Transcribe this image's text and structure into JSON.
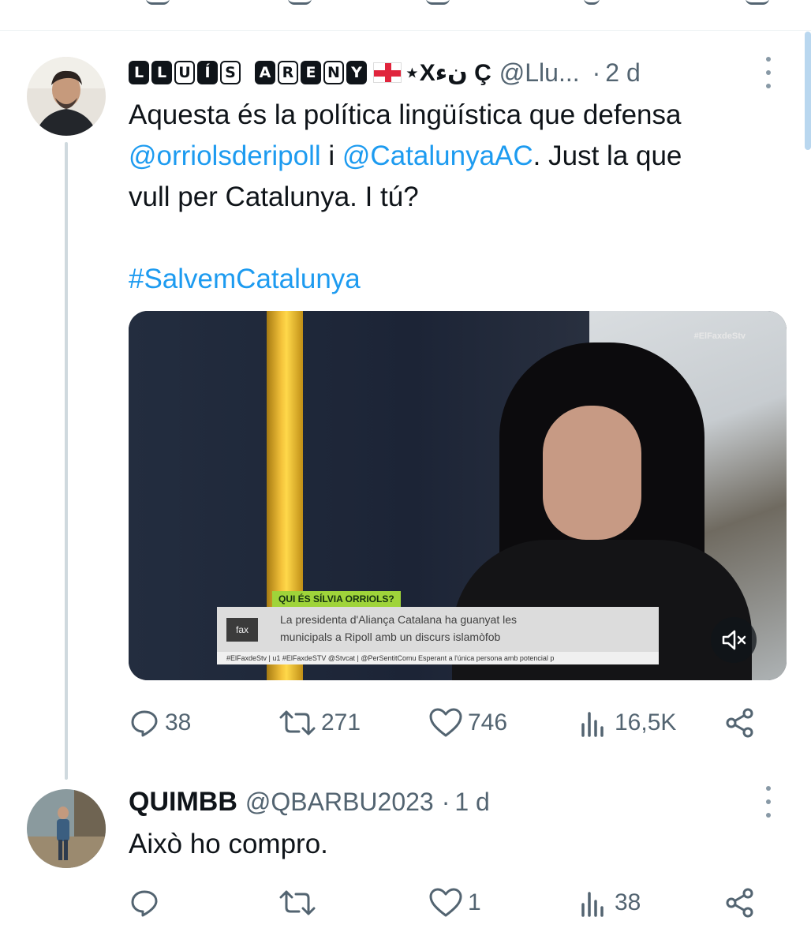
{
  "tweet1": {
    "display_name_words": [
      [
        "L",
        "L",
        "U",
        "Í",
        "S"
      ],
      [
        "A",
        "R",
        "E",
        "N",
        "Y"
      ]
    ],
    "name_decor": "⋆Xنﺀ Ç",
    "handle": "@Llu...",
    "separator": "·",
    "time": "2 d",
    "text_line1": "Aquesta és la política lingüística que defensa",
    "mention1": "@orriolsderipoll",
    "conj": " i ",
    "mention2": "@CatalunyaAC",
    "text_line2_rest": ". Just la que",
    "text_line3": "vull per Catalunya. I tú?",
    "hashtag": "#SalvemCatalunya",
    "video": {
      "watermark": "#ElFaxdeStv",
      "logo": "fax",
      "lower_third_tag": "QUI ÉS SÍLVIA ORRIOLS?",
      "lower_third_line1": "La presidenta d'Aliança Catalana ha guanyat les",
      "lower_third_line2": "municipals a Ripoll amb un discurs islamòfob",
      "ticker": "#ElFaxdeStv  |  u1 #ElFaxdeSTV @Stvcat  |  @PerSentitComu Esperant a l'única persona amb potencial p"
    },
    "replies": "38",
    "retweets": "271",
    "likes": "746",
    "views": "16,5K"
  },
  "tweet2": {
    "display_name": "QUIMBB",
    "handle": "@QBARBU2023",
    "separator": "·",
    "time": "1 d",
    "text": "Això ho compro.",
    "replies": "",
    "retweets": "",
    "likes": "1",
    "views": "38"
  },
  "colors": {
    "link": "#1d9bf0",
    "muted": "#536471",
    "text": "#0f1419",
    "thread_line": "#cfd9de"
  }
}
